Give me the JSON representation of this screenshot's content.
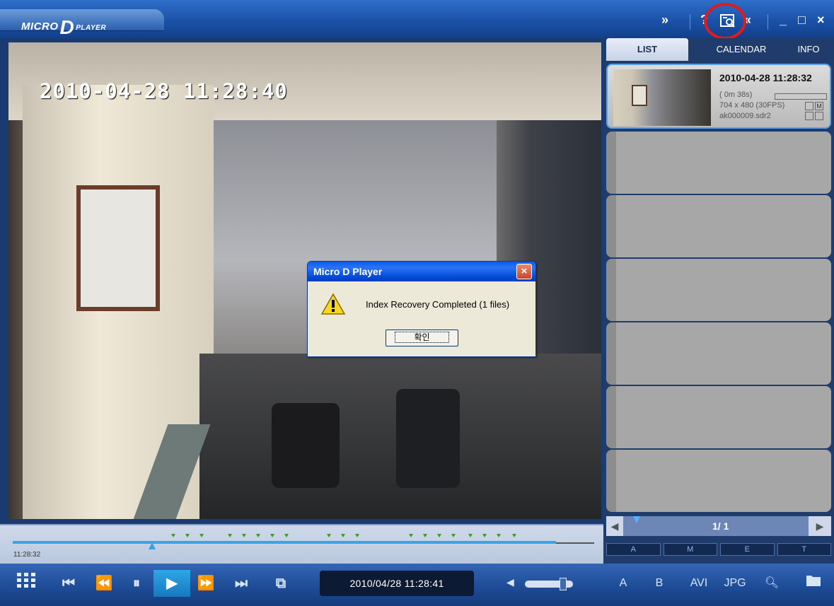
{
  "app": {
    "logo": {
      "left": "MICRO",
      "mid": "D",
      "right": "PLAYER"
    },
    "window_controls": {
      "minimize": "_",
      "maximize": "□",
      "close": "×"
    },
    "title_icons": {
      "extend": "»",
      "help": "?",
      "index_recovery": "index-recovery-icon",
      "back": "«"
    }
  },
  "video": {
    "osd_timestamp": "2010-04-28 11:28:40"
  },
  "dialog": {
    "title": "Micro D Player",
    "close_label": "×",
    "message": "Index Recovery Completed (1 files)",
    "ok_label": "확인"
  },
  "panel": {
    "tabs": [
      {
        "label": "LIST",
        "active": true
      },
      {
        "label": "CALENDAR",
        "active": false
      },
      {
        "label": "INFO",
        "active": false
      }
    ],
    "items": [
      {
        "date": "2010-04-28 11:28:32",
        "duration": "( 0m 38s)",
        "resolution": "704 x 480 (30FPS)",
        "filename": "ak000009.sdr2",
        "badge": "M"
      }
    ],
    "pager": {
      "text": "1/  1",
      "prev": "◀",
      "next": "▶"
    },
    "filters": [
      "A",
      "M",
      "E",
      "T"
    ]
  },
  "timeline": {
    "start_label": "11:28:32",
    "progress_fraction": 0.24,
    "event_marks": 22
  },
  "toolbar": {
    "time_display": "2010/04/28 11:28:41",
    "right_buttons": [
      "A",
      "B",
      "AVI",
      "JPG"
    ],
    "volume_level": 0.8
  },
  "colors": {
    "title_bar": "#1b52a8",
    "dialog_title": "#0a5bec",
    "accent_highlight": "#e41a1a",
    "timeline_fill": "#3aa3e8"
  }
}
